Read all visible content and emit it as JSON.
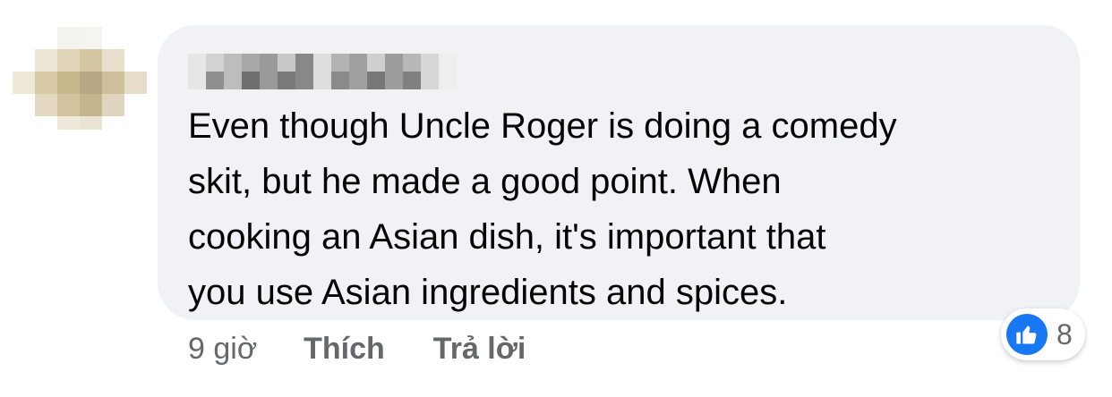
{
  "comment": {
    "author_name": "",
    "text": "Even though Uncle Roger is doing a comedy\nskit, but he made a good point. When\ncooking an Asian dish, it's important that\nyou use Asian ingredients and spices.",
    "time": "9 giờ",
    "like_label": "Thích",
    "reply_label": "Trả lời",
    "reaction_count": "8",
    "reaction_icon": "like-thumbs-up-icon"
  },
  "colors": {
    "bubble_bg": "#f0f2f5",
    "text": "#050505",
    "secondary_text": "#65676b",
    "like_blue": "#1877f2"
  }
}
